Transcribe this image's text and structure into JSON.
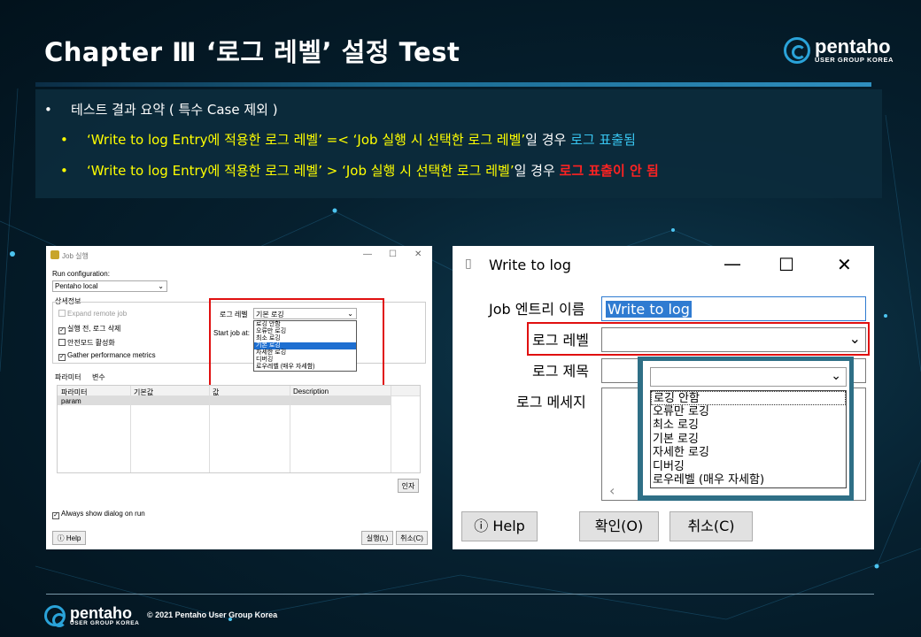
{
  "slide": {
    "title": "Chapter Ⅲ   ‘로그 레벨’ 설정 Test",
    "logo_name": "pentaho",
    "logo_sub": "USER GROUP KOREA",
    "copyright": "© 2021 Pentaho User Group Korea"
  },
  "summary": {
    "heading": "테스트 결과 요약 ( 특수 Case 제외 )",
    "line1_a": "‘Write to log Entry",
    "line1_b": "에 적용한 로그 레벨’ =< ‘Job 실행 시 선택한 로그 레벨’",
    "line1_c": "일 경우 ",
    "line1_d": "로그 표출됨",
    "line2_a": "‘Write to log Entry",
    "line2_b": "에 적용한 로그 레벨’ > ‘Job 실행 시 선택한 로그 레벨’",
    "line2_c": "일 경우 ",
    "line2_d": "로그 표출이 안 됨",
    "bullet": "•",
    "colors": {
      "highlight": "#ffff00",
      "positive": "#38c5f0",
      "negative": "#ff2222"
    }
  },
  "job_dialog": {
    "title": "Job 실행",
    "run_config_label": "Run configuration:",
    "run_config_value": "Pentaho local",
    "details_label": "상세정보",
    "expand_remote": "Expand remote job",
    "clear_log": "실행 전, 로그 삭제",
    "safe_mode": "안전모드 활성화",
    "gather_metrics": "Gather performance metrics",
    "log_level_label": "로그 레벨",
    "log_level_value": "기본 로깅",
    "start_job_label": "Start job at:",
    "log_options": [
      "로깅 안함",
      "오류만 로깅",
      "최소 로깅",
      "기본 로깅",
      "자세한 로깅",
      "디버깅",
      "로우레벨 (매우 자세함)"
    ],
    "tab_params": "파라미터",
    "tab_vars": "변수",
    "col_param": "파라미터",
    "col_default": "기본값",
    "col_value": "값",
    "col_desc": "Description",
    "param_row": "param",
    "args_button": "인자",
    "always_show": "Always show dialog on run",
    "help_button": "Help",
    "run_button": "실행(L)",
    "cancel_button": "취소(C)"
  },
  "write_dialog": {
    "title": "Write to log",
    "entry_name_label": "Job 엔트리 이름",
    "entry_name_value": "Write to log",
    "log_level_label": "로그 레벨",
    "log_subject_label": "로그 제목",
    "log_message_label": "로그 메세지",
    "log_options": [
      "로깅 안함",
      "오류만 로깅",
      "최소 로깅",
      "기본 로깅",
      "자세한 로깅",
      "디버깅",
      "로우레벨 (매우 자세함)"
    ],
    "help_button": "Help",
    "ok_button": "확인(O)",
    "cancel_button": "취소(C)"
  }
}
